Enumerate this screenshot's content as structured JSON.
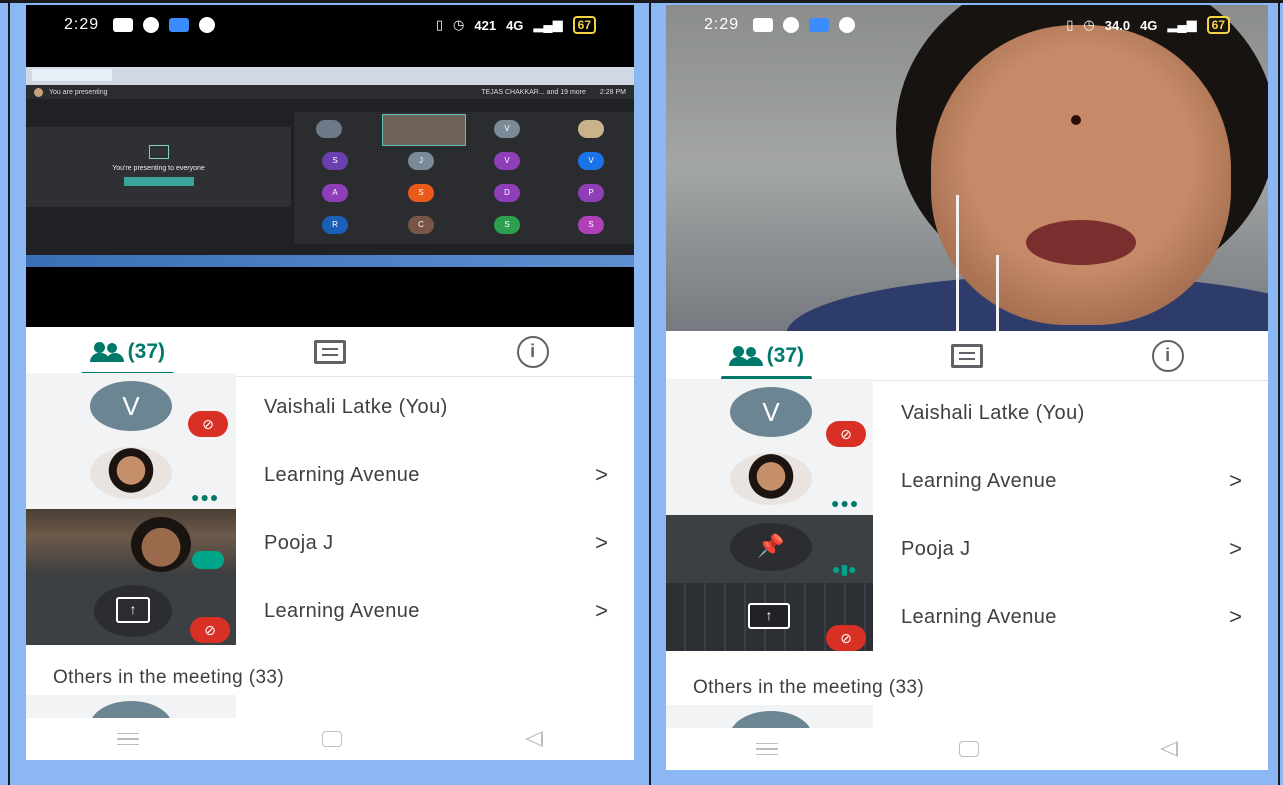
{
  "status": {
    "time": "2:29",
    "speed_left": "421",
    "speed_right": "34.0",
    "speed_unit": "KB/S",
    "network": "4G",
    "battery": "67"
  },
  "share": {
    "presenting_label": "You are presenting",
    "presenting_to": "You're presenting to everyone",
    "stop_label": "Stop presenting",
    "meet_time": "2:28 PM",
    "participants_label": "TEJAS CHAKKAR... and 19 more",
    "tile_letters": [
      "V",
      "S",
      "J",
      "V",
      "V",
      "A",
      "S",
      "D",
      "P",
      "R",
      "C",
      "S",
      "S"
    ]
  },
  "tabs": {
    "people_count": "(37)"
  },
  "participants": [
    {
      "name": "Vaishali Latke (You)",
      "initial": "V"
    },
    {
      "name": "Learning Avenue",
      "chevron": ">"
    },
    {
      "name": "Pooja J",
      "chevron": ">"
    },
    {
      "name": "Learning Avenue",
      "chevron": ">"
    }
  ],
  "others": {
    "label": "Others in the meeting (33)"
  },
  "colors": {
    "accent": "#00796b",
    "mute_red": "#d93025",
    "background": "#8bb8f2"
  }
}
